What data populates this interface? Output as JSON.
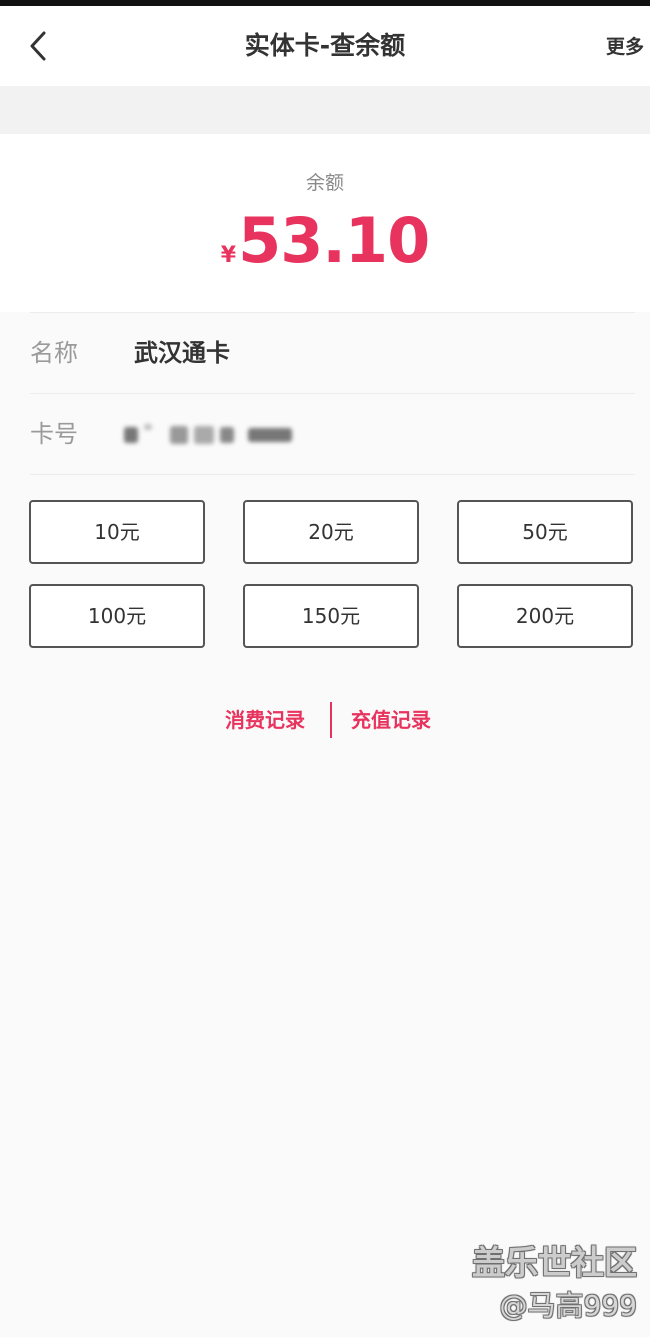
{
  "header": {
    "title": "实体卡-查余额",
    "more_label": "更多",
    "back_icon": "chevron-left-icon"
  },
  "balance": {
    "label": "余额",
    "currency_symbol": "¥",
    "amount": "53.10"
  },
  "card_info": {
    "name_key": "名称",
    "name_value": "武汉通卡",
    "number_key": "卡号"
  },
  "recharge_options": [
    "10元",
    "20元",
    "50元",
    "100元",
    "150元",
    "200元"
  ],
  "links": {
    "consumption": "消费记录",
    "recharge": "充值记录"
  },
  "watermark": {
    "line1": "盖乐世社区",
    "line2": "@马高999"
  },
  "colors": {
    "accent": "#e8335e",
    "text": "#333333",
    "muted": "#9a9a9a"
  }
}
